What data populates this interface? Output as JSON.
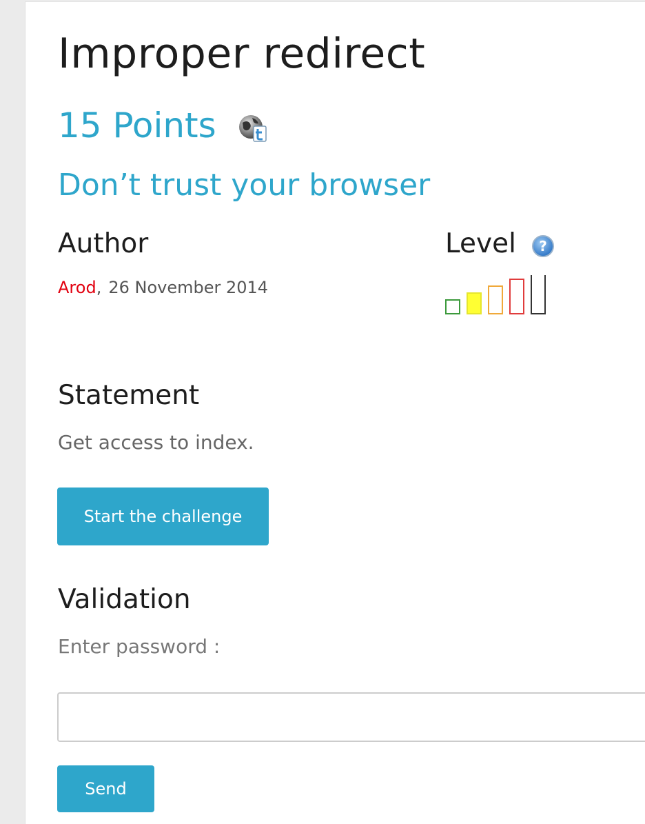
{
  "challenge": {
    "title": "Improper redirect",
    "points": "15 Points",
    "subtitle": "Don’t trust your browser"
  },
  "author_section": {
    "heading": "Author",
    "name": "Arod",
    "separator": ",",
    "date": "26 November 2014"
  },
  "level_section": {
    "heading": "Level",
    "help_icon": "help-question-icon",
    "levels": [
      {
        "level": 1,
        "color": "#3c9a3c",
        "filled": false
      },
      {
        "level": 2,
        "color": "#ffff33",
        "filled": true
      },
      {
        "level": 3,
        "color": "#f0a93a",
        "filled": false
      },
      {
        "level": 4,
        "color": "#e03c3c",
        "filled": false
      },
      {
        "level": 5,
        "color": "#333333",
        "filled": false
      }
    ],
    "current_level": 2
  },
  "statement": {
    "heading": "Statement",
    "text": "Get access to index."
  },
  "start_button": {
    "label": "Start the challenge"
  },
  "validation": {
    "heading": "Validation",
    "password_label": "Enter password :",
    "password_value": "",
    "send_label": "Send"
  },
  "icons": {
    "share": "web-share-icon"
  },
  "colors": {
    "accent": "#2ea6cb",
    "author_link": "#e2000f",
    "background": "#ebebeb"
  }
}
